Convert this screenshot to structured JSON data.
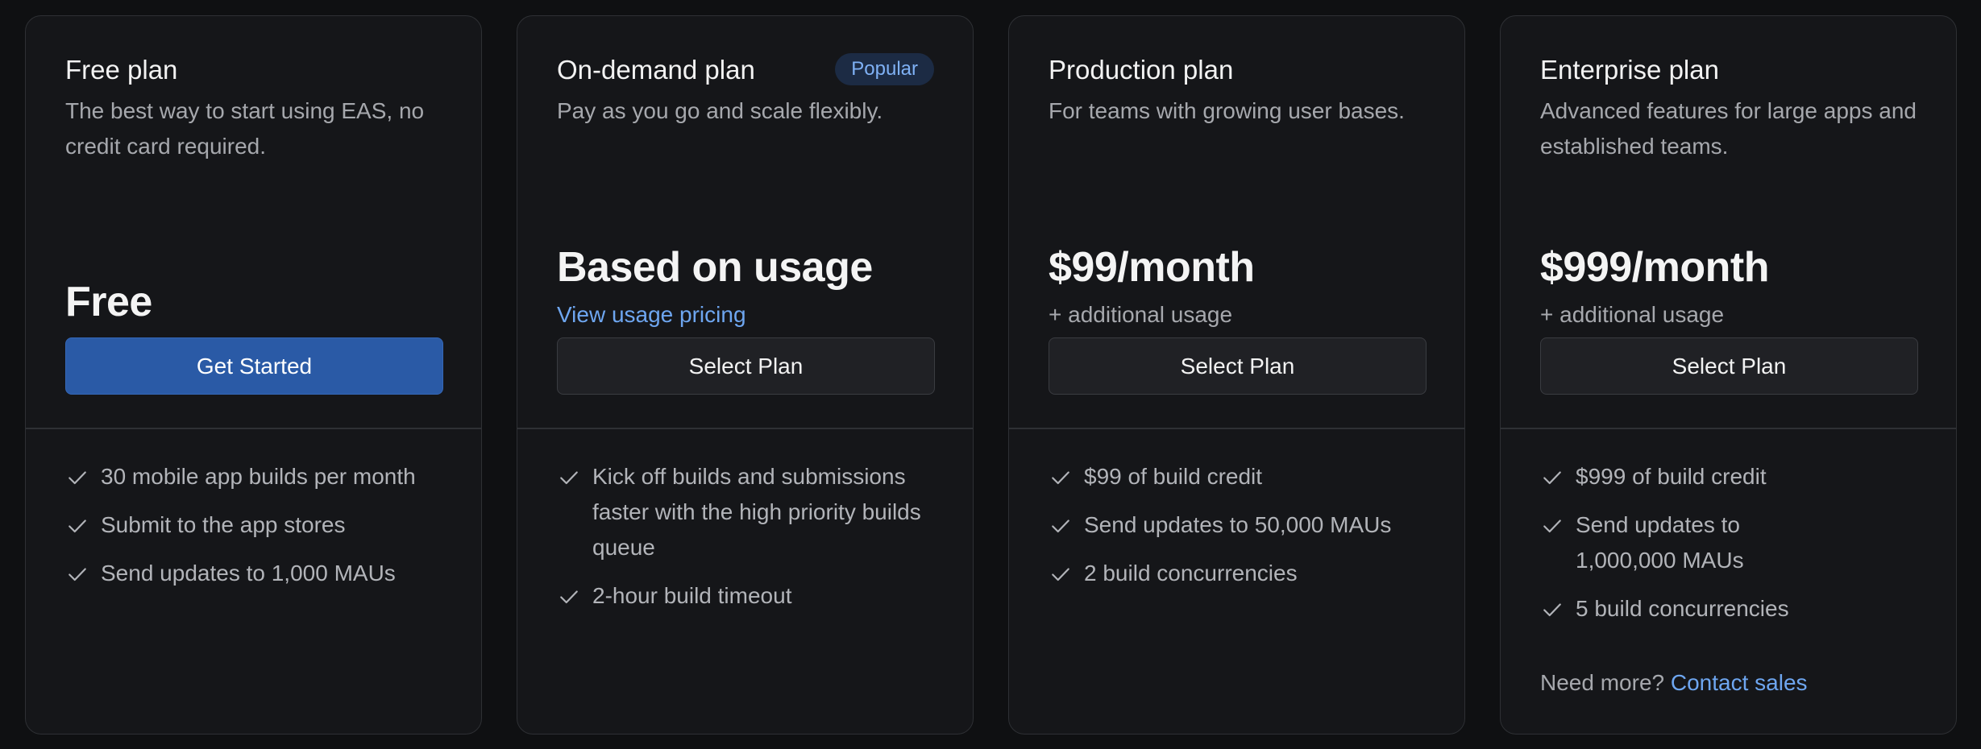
{
  "plans": [
    {
      "title": "Free plan",
      "badge": "",
      "description": "The best way to start using EAS, no credit card required.",
      "price": "Free",
      "price_sub": "",
      "button": "Get Started",
      "features": [
        "30 mobile app builds per month",
        "Submit to the app stores",
        "Send updates to 1,000 MAUs"
      ]
    },
    {
      "title": "On-demand plan",
      "badge": "Popular",
      "description": "Pay as you go and scale flexibly.",
      "price": "Based on usage",
      "price_sub": "View usage pricing",
      "button": "Select Plan",
      "features": [
        "Kick off builds and submissions faster with the high priority builds queue",
        "2-hour build timeout"
      ]
    },
    {
      "title": "Production plan",
      "badge": "",
      "description": "For teams with growing user bases.",
      "price": "$99/month",
      "price_sub": "+ additional usage",
      "button": "Select Plan",
      "features": [
        "$99 of build credit",
        "Send updates to 50,000 MAUs",
        "2 build concurrencies"
      ]
    },
    {
      "title": "Enterprise plan",
      "badge": "",
      "description": "Advanced features for large apps and established teams.",
      "price": "$999/month",
      "price_sub": "+ additional usage",
      "button": "Select Plan",
      "features": [
        "$999 of build credit",
        "Send updates to 1,000,000 MAUs",
        "5 build concurrencies"
      ],
      "contact_prefix": "Need more?",
      "contact_link": "Contact sales"
    }
  ],
  "icons": {
    "feature": "check-icon"
  },
  "colors": {
    "background": "#0f1012",
    "card": "#151619",
    "primary_button": "#2a5aa6",
    "link": "#6ea6f0",
    "badge_bg": "#1c2b44"
  }
}
